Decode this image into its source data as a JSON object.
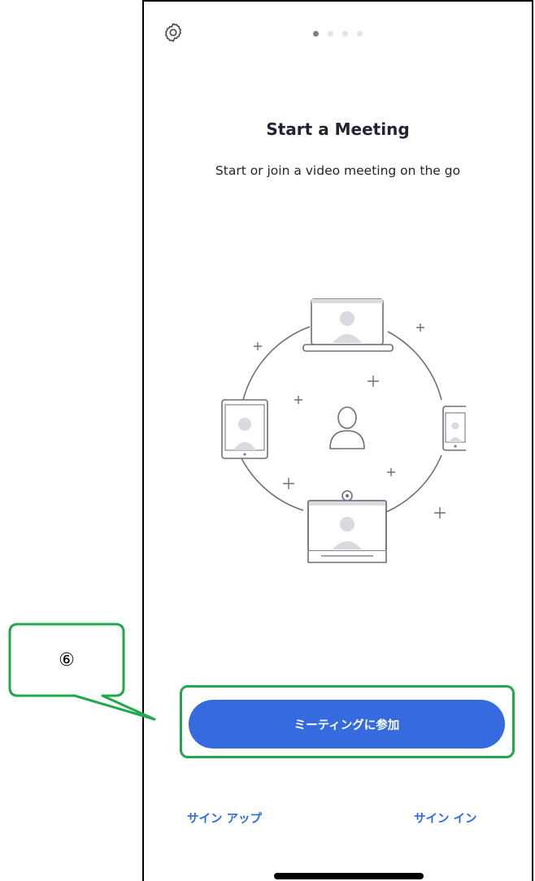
{
  "onboarding": {
    "title": "Start a Meeting",
    "subtitle": "Start or join a video meeting on the go",
    "page_indicator": {
      "count": 4,
      "active_index": 0
    },
    "illustration_icon": "video-meeting-devices-illustration"
  },
  "toolbar": {
    "settings_icon": "gear-icon"
  },
  "actions": {
    "join_meeting_label": "ミーティングに参加",
    "sign_up_label": "サイン アップ",
    "sign_in_label": "サイン イン"
  },
  "annotation": {
    "callout_number": "⑥"
  },
  "colors": {
    "primary_button": "#356bde",
    "link": "#2d6cdf",
    "text": "#232333",
    "annotation_green": "#21a84a"
  }
}
